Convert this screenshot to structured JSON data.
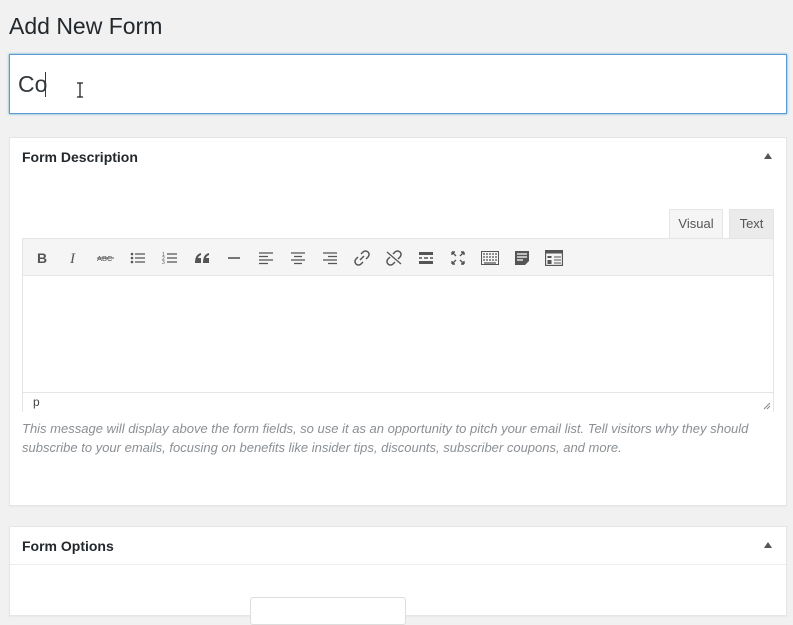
{
  "page": {
    "title": "Add New Form"
  },
  "title_input": {
    "value": "Co"
  },
  "description_box": {
    "title": "Form Description",
    "tabs": [
      {
        "label": "Visual"
      },
      {
        "label": "Text"
      }
    ],
    "toolbar": [
      "bold-icon",
      "italic-icon",
      "strikethrough-icon",
      "bulleted-list-icon",
      "numbered-list-icon",
      "blockquote-icon",
      "horizontal-line-icon",
      "align-left-icon",
      "align-center-icon",
      "align-right-icon",
      "link-icon",
      "unlink-icon",
      "read-more-icon",
      "fullscreen-icon",
      "toolbar-toggle-icon",
      "form-icon",
      "table-icon"
    ],
    "status_path": "p",
    "help_text": "This message will display above the form fields, so use it as an opportunity to pitch your email list. Tell visitors why they should subscribe to your emails, focusing on benefits like insider tips, discounts, subscriber coupons, and more."
  },
  "options_box": {
    "title": "Form Options"
  },
  "colors": {
    "focus": "#5b9dd9",
    "background": "#f1f1f1",
    "help": "#8a8f94"
  }
}
